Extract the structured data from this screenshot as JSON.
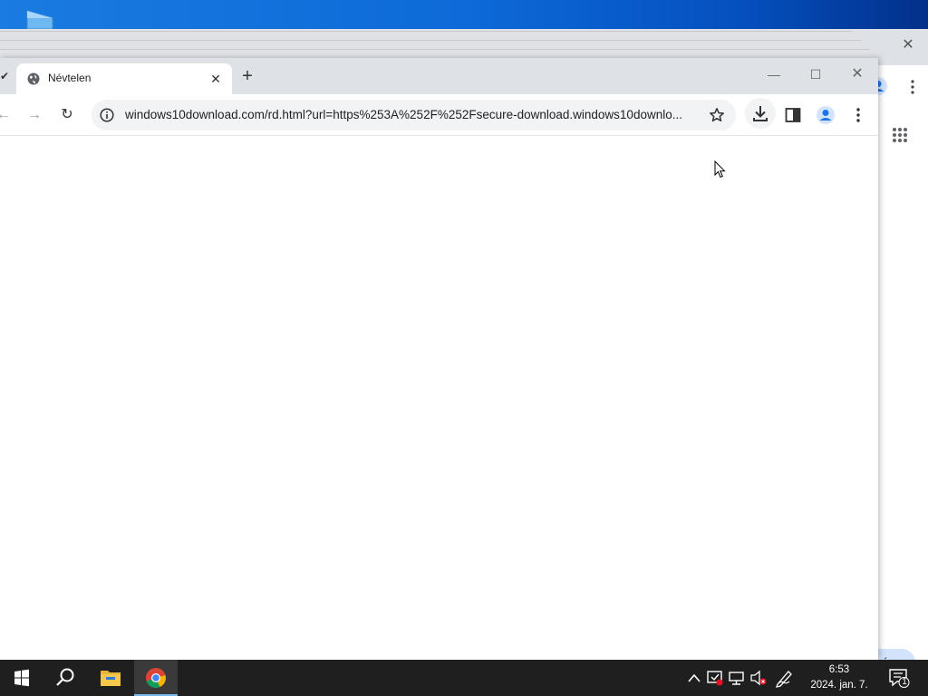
{
  "desktop": {
    "icon": "folder-shortcut-icon"
  },
  "background_window": {
    "chip_label": "bása",
    "icons": [
      "close-icon",
      "profile-icon",
      "menu-dots-icon",
      "apps-grid-icon"
    ]
  },
  "tab": {
    "title": "Névtelen",
    "favicon": "globe-icon",
    "close_label": "✕"
  },
  "new_tab_label": "+",
  "window_controls": {
    "minimize": "—",
    "maximize": "☐",
    "close": "✕"
  },
  "toolbar": {
    "back": "←",
    "forward": "→",
    "reload": "↻",
    "url": "windows10download.com/rd.html?url=https%253A%252F%252Fsecure-download.windows10downlo..."
  },
  "taskbar": {
    "time": "6:53",
    "date": "2024. jan. 7.",
    "notification_count": "1",
    "apps": [
      "start-icon",
      "search-icon",
      "file-explorer-icon",
      "chrome-icon"
    ]
  },
  "colors": {
    "accent": "#76b9ed",
    "profile": "#1a73e8",
    "tabstrip": "#dee1e6"
  }
}
